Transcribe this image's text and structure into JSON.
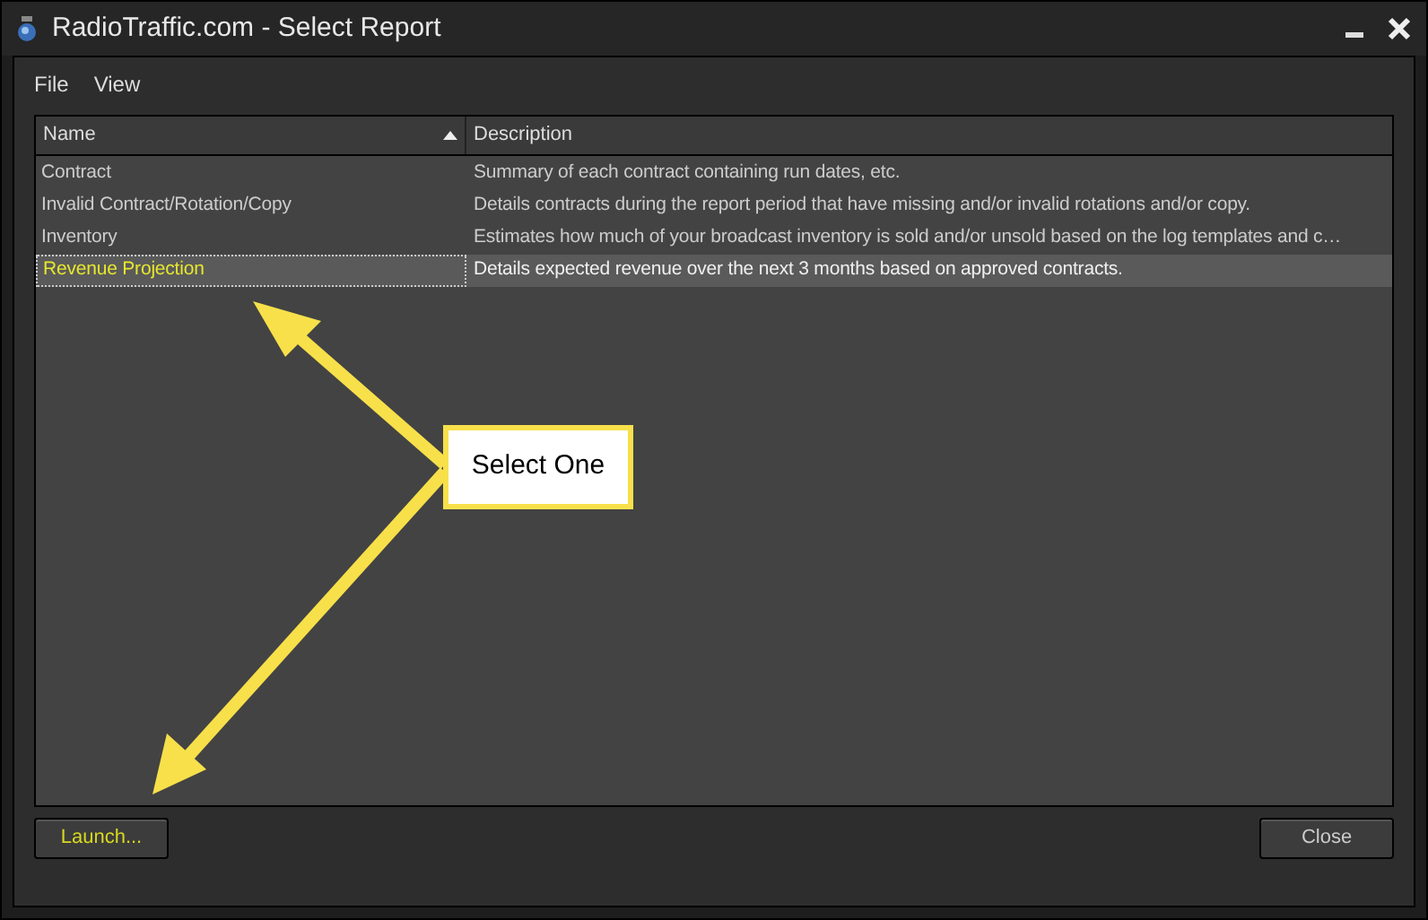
{
  "window": {
    "title": "RadioTraffic.com - Select Report"
  },
  "menu": [
    "File",
    "View"
  ],
  "table": {
    "columns": [
      {
        "label": "Name",
        "sorted": true
      },
      {
        "label": "Description",
        "sorted": false
      }
    ],
    "rows": [
      {
        "name": "Contract",
        "description": "Summary of each contract containing run dates, etc.",
        "selected": false
      },
      {
        "name": "Invalid Contract/Rotation/Copy",
        "description": "Details contracts during the report period that have missing and/or invalid rotations and/or copy.",
        "selected": false
      },
      {
        "name": "Inventory",
        "description": "Estimates how much of your broadcast inventory is sold and/or unsold based on the log templates and c…",
        "selected": false
      },
      {
        "name": "Revenue Projection",
        "description": "Details expected revenue over the next 3 months based on approved contracts.",
        "selected": true
      }
    ]
  },
  "buttons": [
    {
      "label": "Launch...",
      "highlighted": true
    },
    {
      "label": "Close",
      "highlighted": false
    }
  ],
  "callout": {
    "text": "Select One"
  }
}
